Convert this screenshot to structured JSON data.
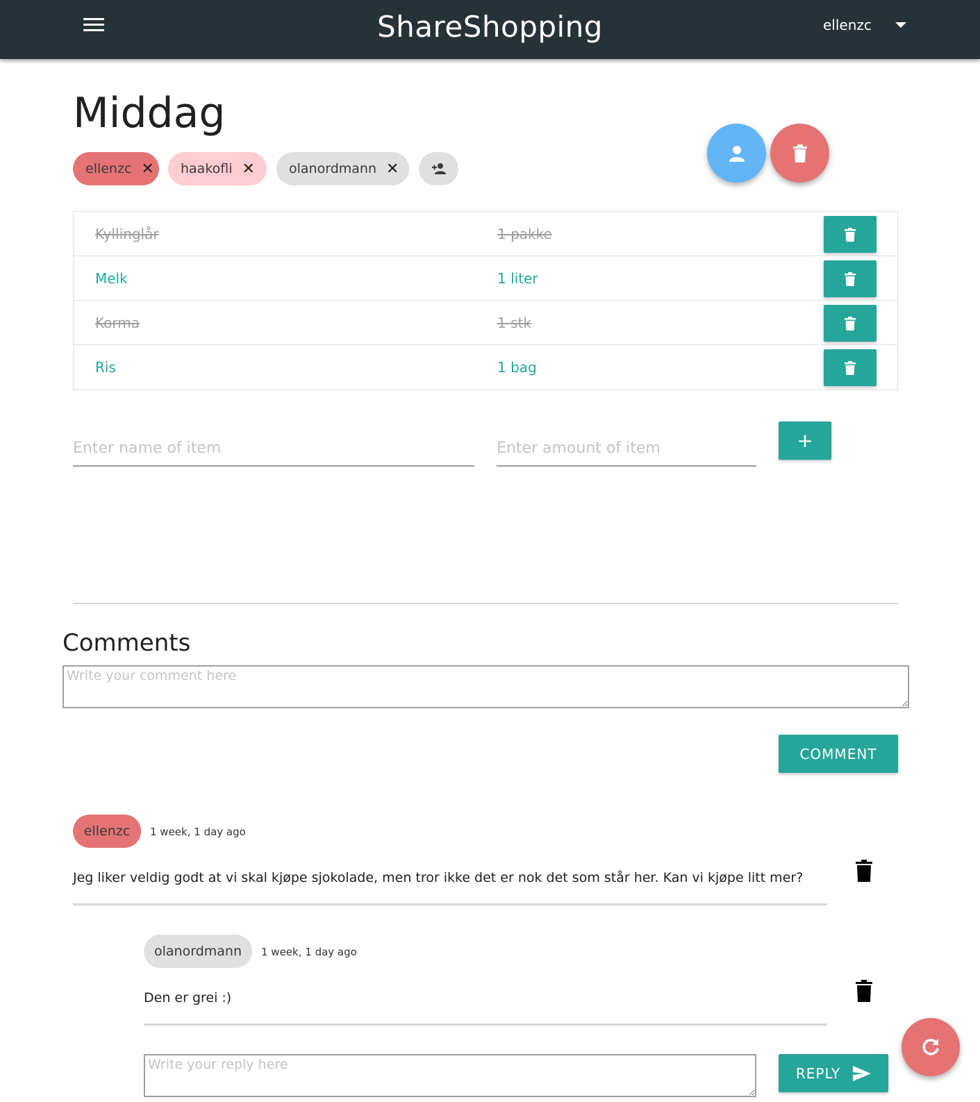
{
  "app": {
    "title": "ShareShopping",
    "user": "ellenzc"
  },
  "list": {
    "title": "Middag",
    "members": [
      {
        "name": "ellenzc",
        "color": "#e57373"
      },
      {
        "name": "haakofli",
        "color": "#ffcdd2"
      },
      {
        "name": "olanordmann",
        "color": "#e0e0e0"
      }
    ],
    "items": [
      {
        "name": "Kyllinglår",
        "amount": "1 pakke",
        "bought": true
      },
      {
        "name": "Melk",
        "amount": "1 liter",
        "bought": false
      },
      {
        "name": "Korma",
        "amount": "1 stk",
        "bought": true
      },
      {
        "name": "Ris",
        "amount": "1 bag",
        "bought": false
      }
    ]
  },
  "add_item": {
    "name_placeholder": "Enter name of item",
    "amount_placeholder": "Enter amount of item",
    "add_label": "+"
  },
  "comments": {
    "title": "Comments",
    "placeholder": "Write your comment here",
    "submit_label": "COMMENT",
    "thread": [
      {
        "author": "ellenzc",
        "time": "1 week, 1 day ago",
        "text": "Jeg liker veldig godt at vi skal kjøpe sjokolade, men tror ikke det er nok det som står her. Kan vi kjøpe litt mer?"
      }
    ],
    "replies": [
      {
        "author": "olanordmann",
        "time": "1 week, 1 day ago",
        "text": "Den er grei :)"
      }
    ],
    "reply_placeholder": "Write your reply here",
    "reply_label": "REPLY"
  },
  "colors": {
    "header_bg": "#263238",
    "accent": "#26a69a",
    "fab_blue": "#64b5f6",
    "fab_red": "#e57373"
  }
}
